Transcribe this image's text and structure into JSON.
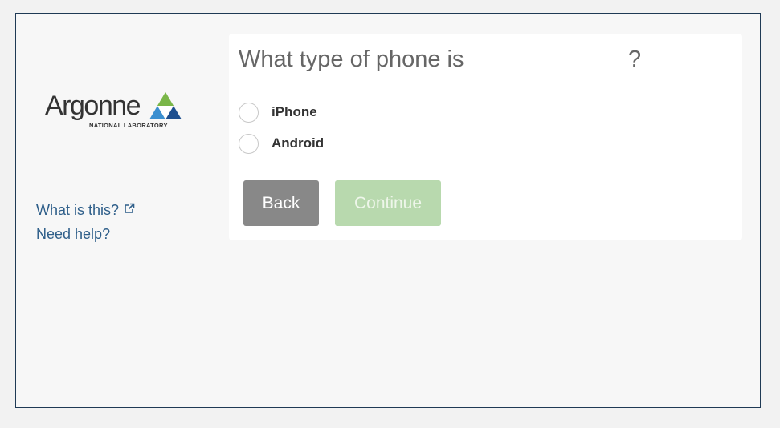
{
  "logo": {
    "name": "Argonne",
    "subtitle": "NATIONAL LABORATORY"
  },
  "side_links": {
    "what_is_this": "What is this?",
    "need_help": "Need help?"
  },
  "prompt": {
    "question": "What type of phone is",
    "question_end": "?"
  },
  "options": [
    {
      "label": "iPhone",
      "selected": false
    },
    {
      "label": "Android",
      "selected": false
    }
  ],
  "buttons": {
    "back": "Back",
    "continue": "Continue",
    "continue_enabled": false
  },
  "colors": {
    "link": "#2f5f8a",
    "back_button": "#888888",
    "continue_button_disabled": "#b8d9ae",
    "frame_border": "#1f3a55"
  },
  "icons": {
    "external_link": "external-link-icon",
    "logo_mark": "argonne-triangle-logo"
  }
}
